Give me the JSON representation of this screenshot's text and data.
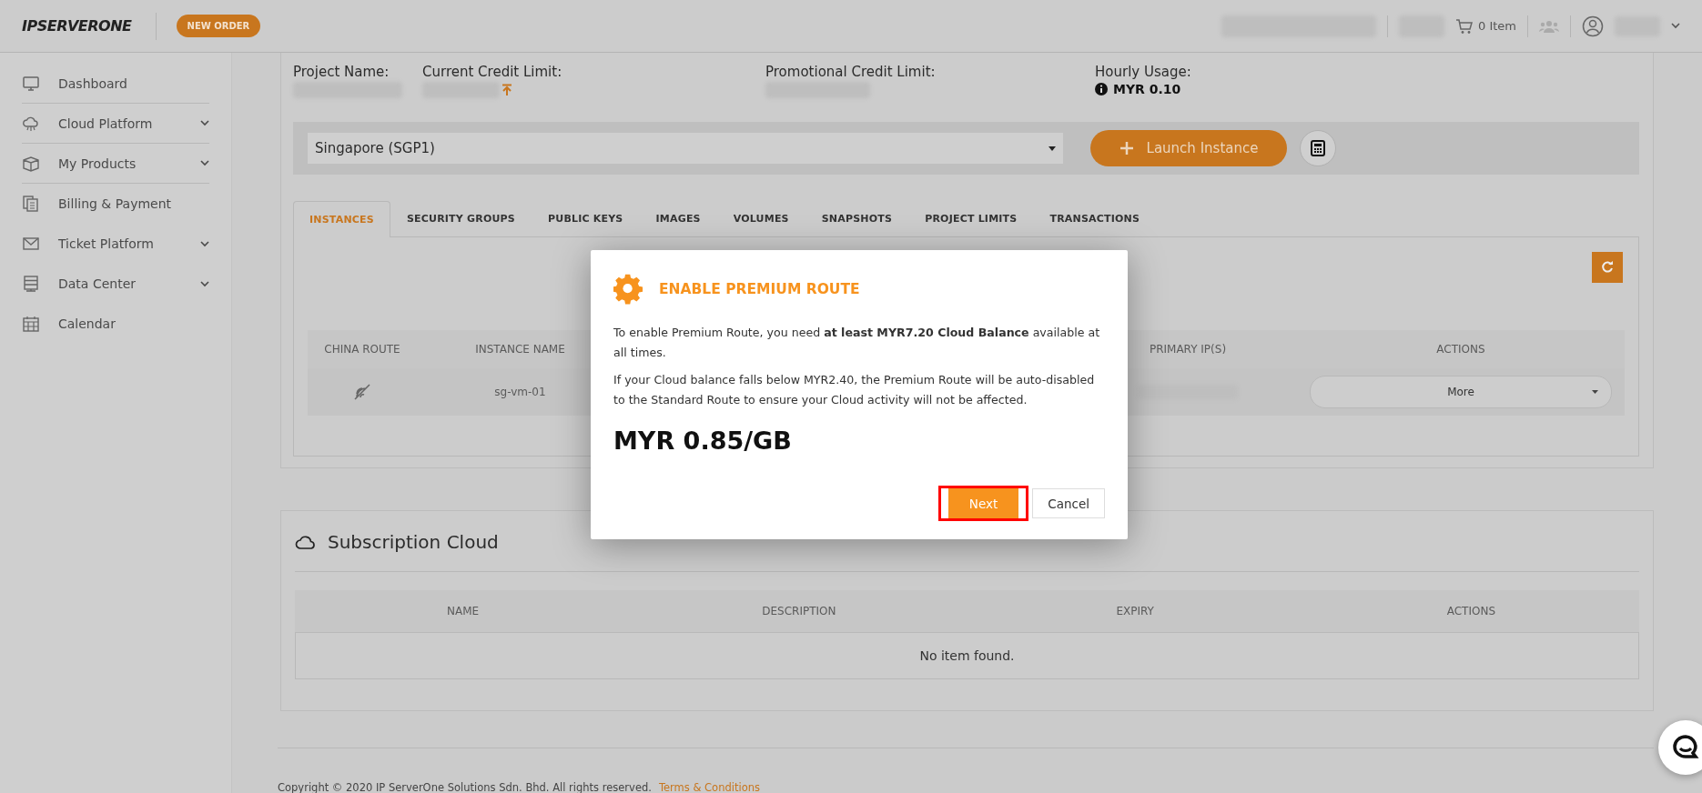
{
  "header": {
    "logo": "IPSERVERONE",
    "new_order_button": "NEW ORDER",
    "cart": "0 Item"
  },
  "sidebar": {
    "items": [
      {
        "label": "Dashboard",
        "expandable": false,
        "separated": true
      },
      {
        "label": "Cloud Platform",
        "expandable": true,
        "separated": true
      },
      {
        "label": "My Products",
        "expandable": true,
        "separated": true
      },
      {
        "label": "Billing & Payment",
        "expandable": false,
        "separated": false
      },
      {
        "label": "Ticket Platform",
        "expandable": true,
        "separated": false
      },
      {
        "label": "Data Center",
        "expandable": true,
        "separated": false
      },
      {
        "label": "Calendar",
        "expandable": false,
        "separated": false
      }
    ]
  },
  "project": {
    "fields": [
      {
        "label": "Project Name:",
        "kind": "hidden"
      },
      {
        "label": "Current Credit Limit:",
        "kind": "hidden_with_icon"
      },
      {
        "label": "Promotional Credit Limit:",
        "kind": "hidden"
      },
      {
        "label": "Hourly Usage:",
        "kind": "value",
        "value": "MYR 0.10"
      }
    ]
  },
  "region_select": {
    "value": "Singapore (SGP1)"
  },
  "launch_button": "Launch Instance",
  "tabs": [
    {
      "label": "INSTANCES",
      "selected": true
    },
    {
      "label": "SECURITY GROUPS",
      "selected": false
    },
    {
      "label": "PUBLIC KEYS",
      "selected": false
    },
    {
      "label": "IMAGES",
      "selected": false
    },
    {
      "label": "VOLUMES",
      "selected": false
    },
    {
      "label": "SNAPSHOTS",
      "selected": false
    },
    {
      "label": "PROJECT LIMITS",
      "selected": false
    },
    {
      "label": "TRANSACTIONS",
      "selected": false
    }
  ],
  "instances_table": {
    "columns": [
      "CHINA ROUTE",
      "INSTANCE NAME",
      "PRIMARY IP(S)",
      "ACTIONS"
    ],
    "rows": [
      {
        "instance_name": "sg-vm-01",
        "action": "More"
      }
    ]
  },
  "subscription": {
    "title": "Subscription Cloud",
    "columns": [
      "NAME",
      "DESCRIPTION",
      "EXPIRY",
      "ACTIONS"
    ],
    "empty_text": "No item found."
  },
  "footer": {
    "copyright": "Copyright © 2020 IP ServerOne Solutions Sdn. Bhd. All rights reserved.",
    "link": "Terms & Conditions"
  },
  "dialog": {
    "title": "ENABLE PREMIUM ROUTE",
    "paragraphs": [
      "To enable Premium Route, you need **at least MYR7.20 Cloud Balance** available at all times.",
      "If your Cloud balance falls below MYR2.40, the Premium Route will be auto-disabled to the Standard Route to ensure your Cloud activity will not be affected."
    ],
    "price": "MYR 0.85/GB",
    "buttons": [
      {
        "label": "Next",
        "kind": "primary",
        "highlighted": true
      },
      {
        "label": "Cancel",
        "kind": "secondary",
        "highlighted": false
      }
    ]
  }
}
